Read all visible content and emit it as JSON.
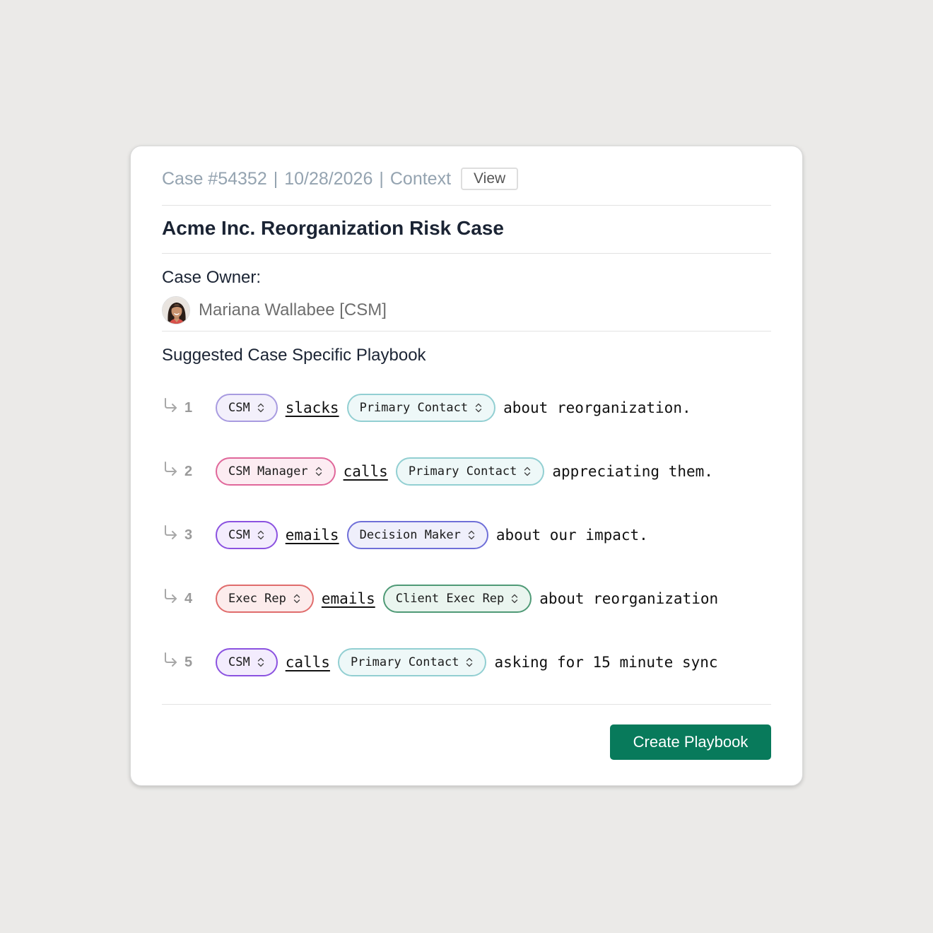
{
  "header": {
    "case_id": "Case #54352",
    "date": "10/28/2026",
    "context_label": "Context",
    "separator": "|",
    "view_label": "View"
  },
  "case_title": "Acme Inc. Reorganization Risk Case",
  "owner": {
    "label": "Case Owner:",
    "name": "Mariana Wallabee [CSM]"
  },
  "playbook": {
    "title": "Suggested Case Specific Playbook",
    "steps": [
      {
        "number": "1",
        "actor": {
          "label": "CSM",
          "border": "#a89be0",
          "bg": "#f3f0fb"
        },
        "verb": "slacks",
        "target": {
          "label": "Primary Contact",
          "border": "#92cfd2",
          "bg": "#eef8f8"
        },
        "rest": "about reorganization."
      },
      {
        "number": "2",
        "actor": {
          "label": "CSM Manager",
          "border": "#e0679a",
          "bg": "#fcecf2"
        },
        "verb": "calls",
        "target": {
          "label": "Primary Contact",
          "border": "#92cfd2",
          "bg": "#eef8f8"
        },
        "rest": "appreciating them."
      },
      {
        "number": "3",
        "actor": {
          "label": "CSM",
          "border": "#8b52e0",
          "bg": "#f3ecfd"
        },
        "verb": "emails",
        "target": {
          "label": "Decision Maker",
          "border": "#6f6fd8",
          "bg": "#efeffb"
        },
        "rest": "about our impact."
      },
      {
        "number": "4",
        "actor": {
          "label": "Exec Rep",
          "border": "#e06c6c",
          "bg": "#fcecec"
        },
        "verb": "emails",
        "target": {
          "label": "Client Exec Rep",
          "border": "#4f9a76",
          "bg": "#eaf5ef"
        },
        "rest": "about reorganization"
      },
      {
        "number": "5",
        "actor": {
          "label": "CSM",
          "border": "#8b52e0",
          "bg": "#f3ecfd"
        },
        "verb": "calls",
        "target": {
          "label": "Primary Contact",
          "border": "#92cfd2",
          "bg": "#eef8f8"
        },
        "rest": "asking for 15 minute sync"
      }
    ]
  },
  "create_button": "Create Playbook",
  "colors": {
    "accent": "#087a5b",
    "meta_text": "#94a3b0",
    "heading": "#1b2434"
  },
  "icons": {
    "step": "return-arrow-icon",
    "pill": "chevron-up-down-icon"
  }
}
